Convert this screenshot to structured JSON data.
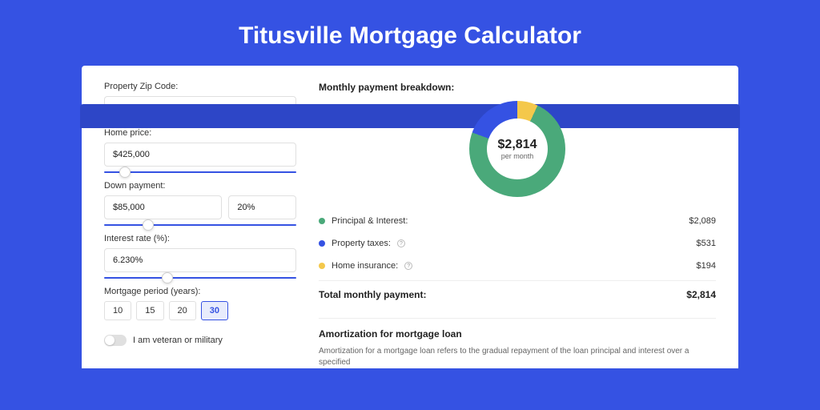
{
  "page": {
    "title": "Titusville Mortgage Calculator"
  },
  "form": {
    "zip": {
      "label": "Property Zip Code:",
      "value": ""
    },
    "home_price": {
      "label": "Home price:",
      "value": "$425,000",
      "slider_pct": 8
    },
    "down_payment": {
      "label": "Down payment:",
      "amount": "$85,000",
      "percent": "20%",
      "slider_pct": 20
    },
    "interest_rate": {
      "label": "Interest rate (%):",
      "value": "6.230%",
      "slider_pct": 30
    },
    "period": {
      "label": "Mortgage period (years):",
      "options": [
        "10",
        "15",
        "20",
        "30"
      ],
      "selected": "30"
    },
    "veteran": {
      "label": "I am veteran or military",
      "checked": false
    }
  },
  "breakdown": {
    "title": "Monthly payment breakdown:",
    "center_amount": "$2,814",
    "center_label": "per month",
    "items": [
      {
        "label": "Principal & Interest:",
        "value": "$2,089",
        "color": "green",
        "help": false
      },
      {
        "label": "Property taxes:",
        "value": "$531",
        "color": "blue",
        "help": true
      },
      {
        "label": "Home insurance:",
        "value": "$194",
        "color": "yellow",
        "help": true
      }
    ],
    "total_label": "Total monthly payment:",
    "total_value": "$2,814"
  },
  "amortization": {
    "title": "Amortization for mortgage loan",
    "text": "Amortization for a mortgage loan refers to the gradual repayment of the loan principal and interest over a specified"
  },
  "chart_data": {
    "type": "pie",
    "title": "Monthly payment breakdown",
    "series": [
      {
        "name": "Principal & Interest",
        "value": 2089,
        "color": "#4aa97a"
      },
      {
        "name": "Property taxes",
        "value": 531,
        "color": "#3552e3"
      },
      {
        "name": "Home insurance",
        "value": 194,
        "color": "#f4c84b"
      }
    ],
    "total": 2814,
    "center_label": "per month"
  }
}
